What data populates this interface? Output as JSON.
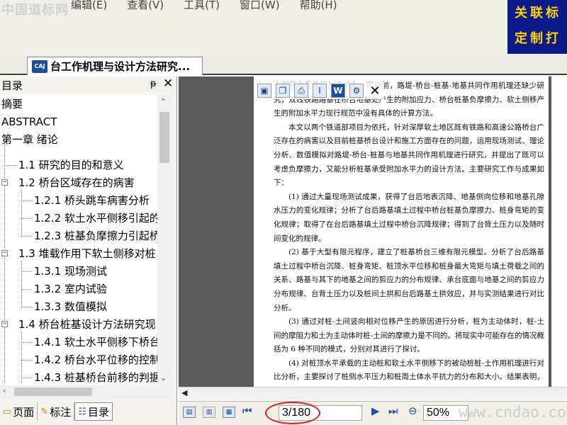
{
  "watermark_logo": "中国道标网",
  "menu": [
    "编辑(E)",
    "查看(V)",
    "工具(T)",
    "窗口(W)",
    "帮助(H)"
  ],
  "ad": {
    "line1": "关联标",
    "line2": "定制打"
  },
  "doc_tab": {
    "icon": "CAJ",
    "title": "台工作机理与设计方法研究..."
  },
  "outline_panel": {
    "title": "目录",
    "pin_icon": "ᵽ",
    "close_icon": "✕",
    "items": [
      "摘要",
      "ABSTRACT",
      "第一章 绪论",
      "1.1 研究的目的和意义",
      "1.2 桥台区域存在的病害",
      "1.2.1 桥头跳车病害分析",
      "1.2.2 软土水平侧移引起的",
      "1.2.3 桩基负摩擦力引起桥",
      "1.3 堆载作用下软土侧移对桩",
      "1.3.1 现场测试",
      "1.3.2 室内试验",
      "1.3.3 数值模拟",
      "1.4 桥台桩基设计方法研究现",
      "1.4.1 软土水平侧移下桥台",
      "1.4.2 桥台水平位移的控制",
      "1.4.3 桩基桥台前移的判据"
    ],
    "tabs": [
      "页面",
      "标注",
      "目录"
    ]
  },
  "floating_toolbar": {
    "close": "✕"
  },
  "document": {
    "paragraphs": [
      "土侧移产生的附加水平力，而目前，路堤-桥台-桩基-地基共同作用机理还缺少研究，双线铁路路基在桥台地基处产生的附加应力、桥台桩基负摩擦力、软土侧移产生的附加水平力现行规范中没有具体的计算方法。",
      "本文以两个铁道部项目为依托，针对深厚软土地区既有铁路和高速公路桥台广泛存在的病害以及目前桩基桥台设计和施工方面存在的问题，运用现场测试、理论分析、数值模拟对路堤-桥台-桩基与地基共同作用机理进行研究，并提出了既可以考虑负摩擦力，又能分析桩基承受附加水平力的设计方法。主要研究工作与成果如下：",
      "(1) 通过大量现场测试成果，获得了台后地表沉降、地基侧向位移和地基孔隙水压力的变化规律；分析了台后路基填土过程中桥台桩基负摩擦力、桩身弯矩的变化规律；取得了在台后路基填土过程中桥台沉降规律；得到了台背土压力以及随时间变化的规律。",
      "(2) 基于大型有限元程序，建立了桩基桥台三维有限元模型。分析了台后路基填土过程中桥台沉降、桩身弯矩、桩顶水平位移和桩身最大弯矩与填土荷载之间的关系、路基与其下的地基之间的剪应力的分布规律、承台底面与地基之间的剪应力分布规律、台背土压力以及桩间土拱和台后路基土拱效应，并与实测结果进行对比分析。",
      "(3) 通过对桩-土间竖向相对位移产生的原因进行分析，桩为主动体时，桩-土间的摩阻力和土为主动体时桩-土间的摩擦力是不同的。将现实中可能存在的情况概括为 6 种不同的模式，分别对其进行了探讨。",
      "(4) 对桩顶水平承载的主动桩和软土水平侧移下的被动桩桩-土作用机理进行对比分析，主要探讨了桩侧水平压力和桩周土体水平抗力的分布和大小。结果表明，被动桩主动侧水平压力要大于主动桩中土体的水平抗力，而主动桩的水平抗力、被动桩主动侧水平压力及被动桩侧压力差随荷"
    ]
  },
  "navigation": {
    "page_indicator": "3/180",
    "zoom": "50%",
    "site_watermark": "www.cndao.com"
  },
  "colors": {
    "highlight_circle": "#e01e1e",
    "ad_background": "#0b1c8a",
    "ad_text": "#ffd200"
  }
}
